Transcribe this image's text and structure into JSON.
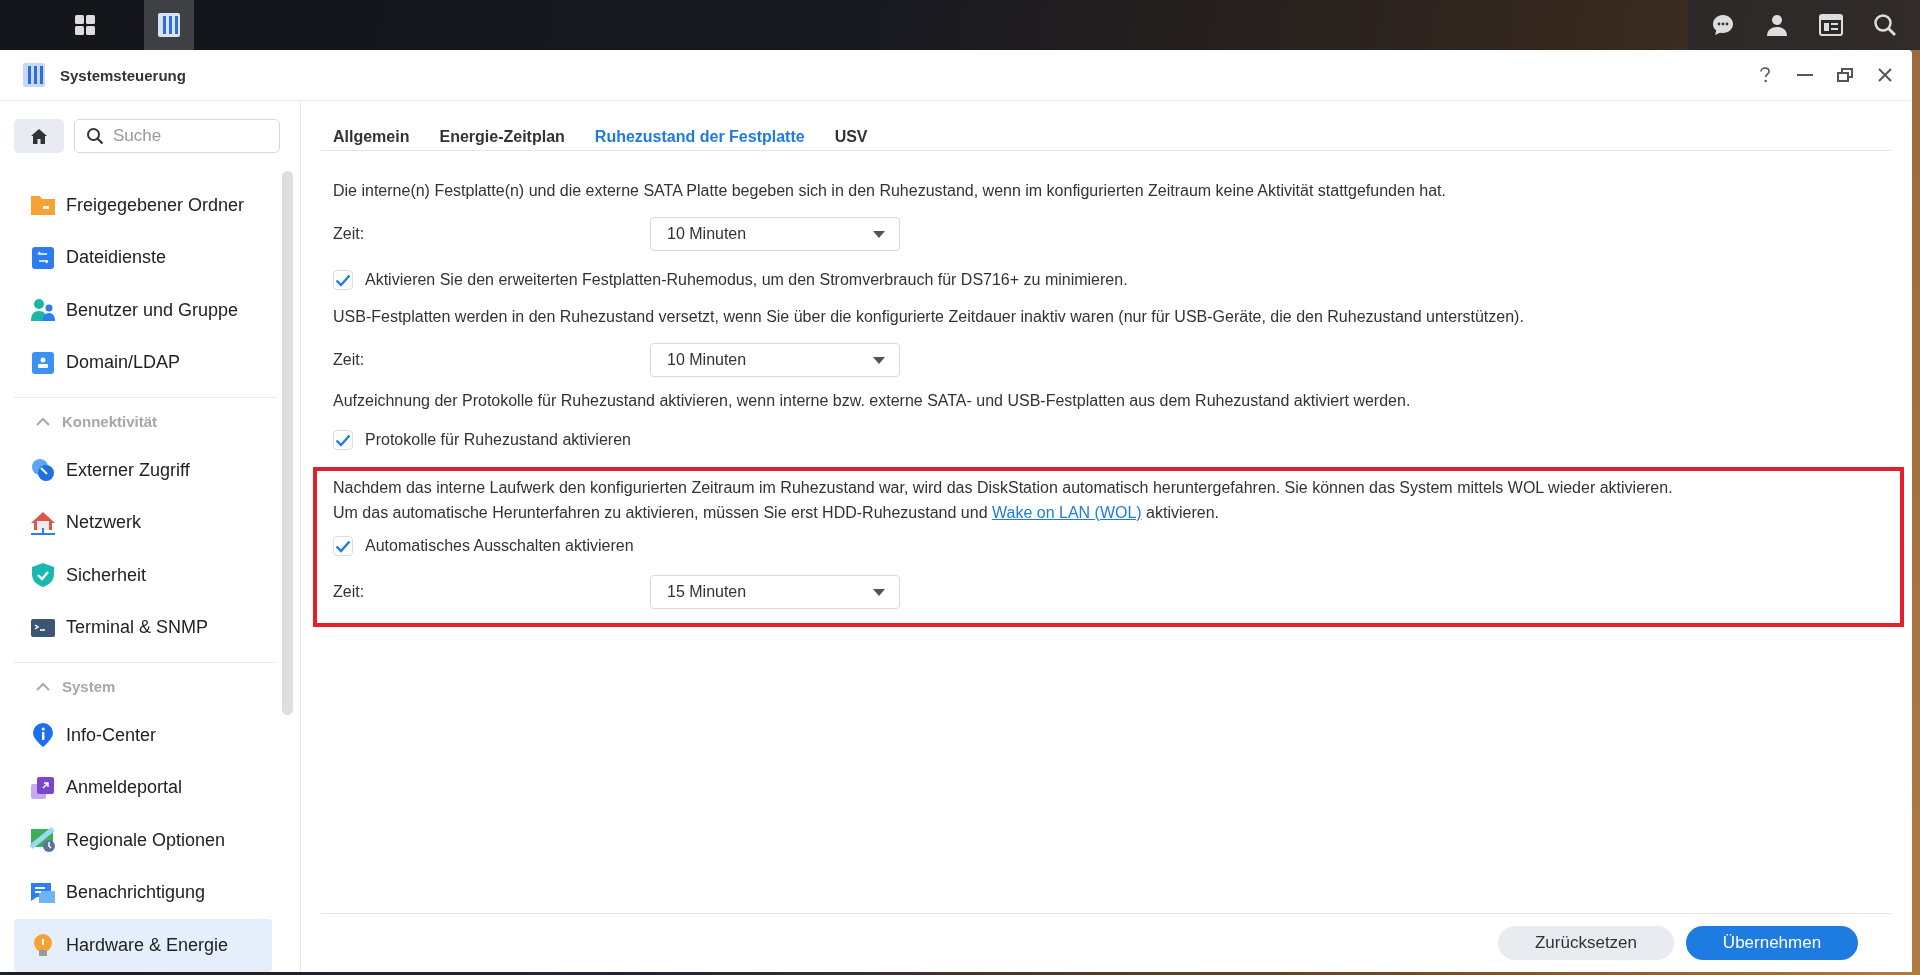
{
  "window": {
    "title": "Systemsteuerung"
  },
  "search": {
    "placeholder": "Suche"
  },
  "sidebar": {
    "groups": [
      {
        "items": [
          {
            "label": "Freigegebener Ordner",
            "selected": false
          },
          {
            "label": "Dateidienste",
            "selected": false
          },
          {
            "label": "Benutzer und Gruppe",
            "selected": false
          },
          {
            "label": "Domain/LDAP",
            "selected": false
          }
        ]
      },
      {
        "header": "Konnektivität",
        "expanded": true,
        "items": [
          {
            "label": "Externer Zugriff",
            "selected": false
          },
          {
            "label": "Netzwerk",
            "selected": false
          },
          {
            "label": "Sicherheit",
            "selected": false
          },
          {
            "label": "Terminal & SNMP",
            "selected": false
          }
        ]
      },
      {
        "header": "System",
        "expanded": true,
        "items": [
          {
            "label": "Info-Center",
            "selected": false
          },
          {
            "label": "Anmeldeportal",
            "selected": false
          },
          {
            "label": "Regionale Optionen",
            "selected": false
          },
          {
            "label": "Benachrichtigung",
            "selected": false
          },
          {
            "label": "Hardware & Energie",
            "selected": true
          }
        ]
      }
    ]
  },
  "tabs": [
    {
      "label": "Allgemein",
      "selected": false
    },
    {
      "label": "Energie-Zeitplan",
      "selected": false
    },
    {
      "label": "Ruhezustand der Festplatte",
      "selected": true
    },
    {
      "label": "USV",
      "selected": false
    }
  ],
  "sections": [
    {
      "highlighted": false,
      "rows": [
        {
          "kind": "text",
          "text": "Die interne(n) Festplatte(n) und die externe SATA Platte begeben sich in den Ruhezustand, wenn im konfigurierten Zeitraum keine Aktivität stattgefunden hat."
        },
        {
          "kind": "select",
          "label": "Zeit:",
          "value": "10 Minuten"
        },
        {
          "kind": "checkbox",
          "label": "Aktivieren Sie den erweiterten Festplatten-Ruhemodus, um den Stromverbrauch für DS716+ zu minimieren.",
          "checked": true
        },
        {
          "kind": "text",
          "text": "USB-Festplatten werden in den Ruhezustand versetzt, wenn Sie über die konfigurierte Zeitdauer inaktiv waren (nur für USB-Geräte, die den Ruhezustand unterstützen)."
        },
        {
          "kind": "select",
          "label": "Zeit:",
          "value": "10 Minuten"
        },
        {
          "kind": "text",
          "text": "Aufzeichnung der Protokolle für Ruhezustand aktivieren, wenn interne bzw. externe SATA- und USB-Festplatten aus dem Ruhezustand aktiviert werden."
        },
        {
          "kind": "checkbox",
          "label": "Protokolle für Ruhezustand aktivieren",
          "checked": true
        }
      ]
    },
    {
      "highlighted": true,
      "rows": [
        {
          "kind": "text",
          "text": "Nachdem das interne Laufwerk den konfigurierten Zeitraum im Ruhezustand war, wird das DiskStation automatisch heruntergefahren. Sie können das System mittels WOL wieder aktivieren."
        },
        {
          "kind": "linktext",
          "before": "Um das automatische Herunterfahren zu aktivieren, müssen Sie erst HDD-Ruhezustand und",
          "link": "Wake on LAN (WOL)",
          "after": "aktivieren."
        },
        {
          "kind": "checkbox",
          "label": "Automatisches Ausschalten aktivieren",
          "checked": true
        },
        {
          "kind": "select",
          "label": "Zeit:",
          "value": "15 Minuten"
        }
      ]
    }
  ],
  "buttons": [
    {
      "label": "Zurücksetzen",
      "primary": false
    },
    {
      "label": "Übernehmen",
      "primary": true
    }
  ]
}
